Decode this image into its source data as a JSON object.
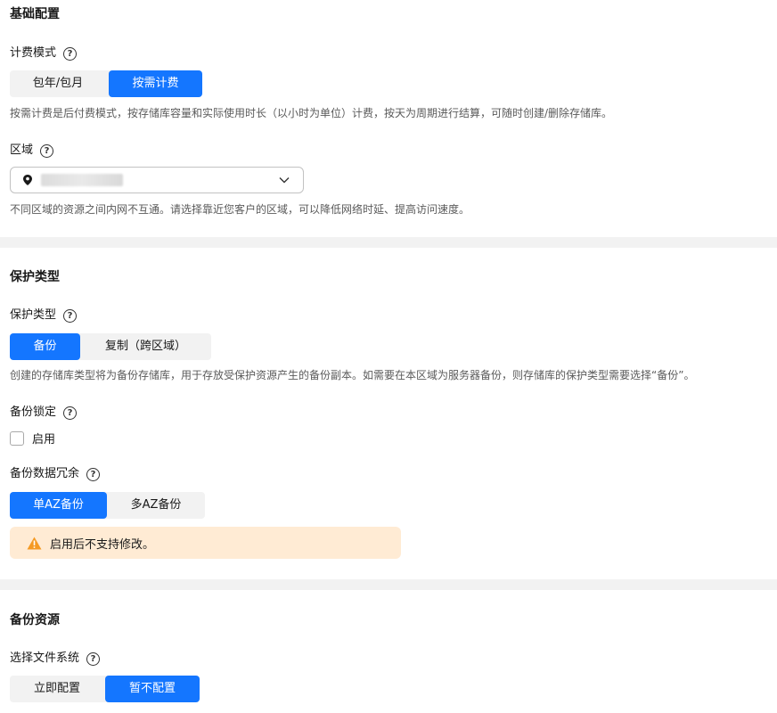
{
  "basic": {
    "title": "基础配置",
    "billing_label": "计费模式",
    "billing_options": [
      "包年/包月",
      "按需计费"
    ],
    "billing_desc": "按需计费是后付费模式，按存储库容量和实际使用时长（以小时为单位）计费，按天为周期进行结算，可随时创建/删除存储库。",
    "region_label": "区域",
    "region_desc": "不同区域的资源之间内网不互通。请选择靠近您客户的区域，可以降低网络时延、提高访问速度。"
  },
  "protection": {
    "title": "保护类型",
    "type_label": "保护类型",
    "type_options": [
      "备份",
      "复制（跨区域）"
    ],
    "type_desc": "创建的存储库类型将为备份存储库，用于存放受保护资源产生的备份副本。如需要在本区域为服务器备份，则存储库的保护类型需要选择“备份”。",
    "lock_label": "备份锁定",
    "lock_checkbox_label": "启用",
    "redundancy_label": "备份数据冗余",
    "redundancy_options": [
      "单AZ备份",
      "多AZ备份"
    ],
    "warning_text": "启用后不支持修改。"
  },
  "resources": {
    "title": "备份资源",
    "fs_label": "选择文件系统",
    "fs_options": [
      "立即配置",
      "暂不配置"
    ]
  },
  "colors": {
    "primary": "#1476ff",
    "warning_bg": "#ffebd4",
    "warning_icon": "#f59a23"
  }
}
